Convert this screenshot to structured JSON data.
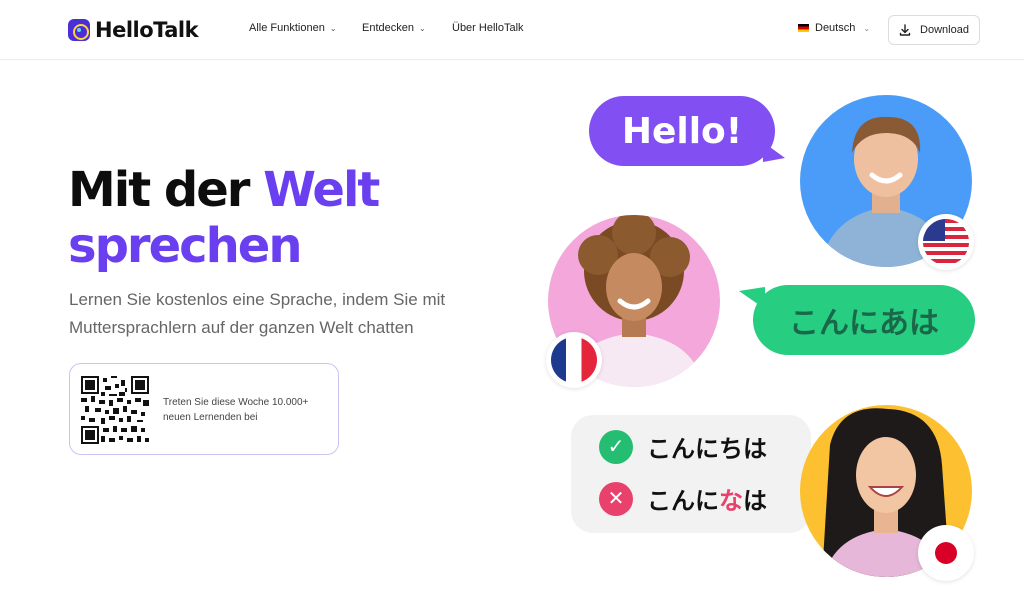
{
  "header": {
    "logo_text": "HelloTalk",
    "nav": [
      {
        "label": "Alle Funktionen",
        "chevron": "chevron-down-icon"
      },
      {
        "label": "Entdecken",
        "chevron": "chevron-down-icon"
      },
      {
        "label": "Über HelloTalk"
      }
    ],
    "language": {
      "label": "Deutsch",
      "flag": "germany-flag-icon"
    },
    "download_label": "Download"
  },
  "hero": {
    "title_part1": "Mit der ",
    "title_accent1": "Welt",
    "title_accent2": "sprechen",
    "subtitle": "Lernen Sie kostenlos eine Sprache, indem Sie mit Muttersprachlern auf der ganzen Welt chatten",
    "qr_text": "Treten Sie diese Woche 10.000+ neuen Lernenden bei"
  },
  "illustration": {
    "bubble_hello": "Hello!",
    "bubble_jp": "こんにあは",
    "quiz": {
      "correct": "こんにちは",
      "wrong_prefix": "こんに",
      "wrong_char": "な",
      "wrong_suffix": "は"
    }
  },
  "colors": {
    "accent": "#6a3ff0",
    "purple_bubble": "#8250f2",
    "green_bubble": "#27cd80",
    "correct": "#24bd72",
    "wrong": "#e8416b"
  }
}
